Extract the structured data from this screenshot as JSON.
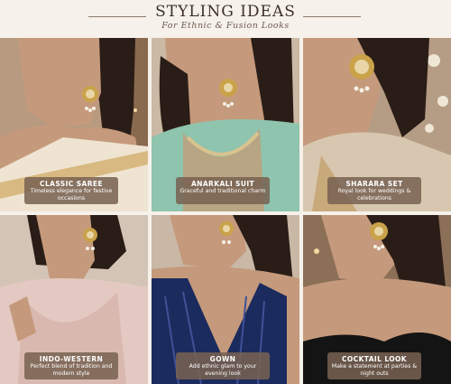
{
  "header": {
    "title": "STYLING IDEAS",
    "subtitle": "For Ethnic & Fusion Looks"
  },
  "looks": [
    {
      "title": "CLASSIC SAREE",
      "description": "Timeless elegance for festive occasions"
    },
    {
      "title": "ANARKALI SUIT",
      "description": "Graceful and traditional charm"
    },
    {
      "title": "SHARARA SET",
      "description": "Royal look for weddings & celebrations"
    },
    {
      "title": "INDO-WESTERN",
      "description": "Perfect blend of tradition and modern style"
    },
    {
      "title": "GOWN",
      "description": "Add ethnic glam to your evening look"
    },
    {
      "title": "COCKTAIL LOOK",
      "description": "Make a statement at parties & night outs"
    }
  ],
  "colors": {
    "background": "#f6f1ea",
    "caption_bg": "#786252",
    "title_text": "#3b2f2a",
    "gold": "#c9a24a"
  }
}
